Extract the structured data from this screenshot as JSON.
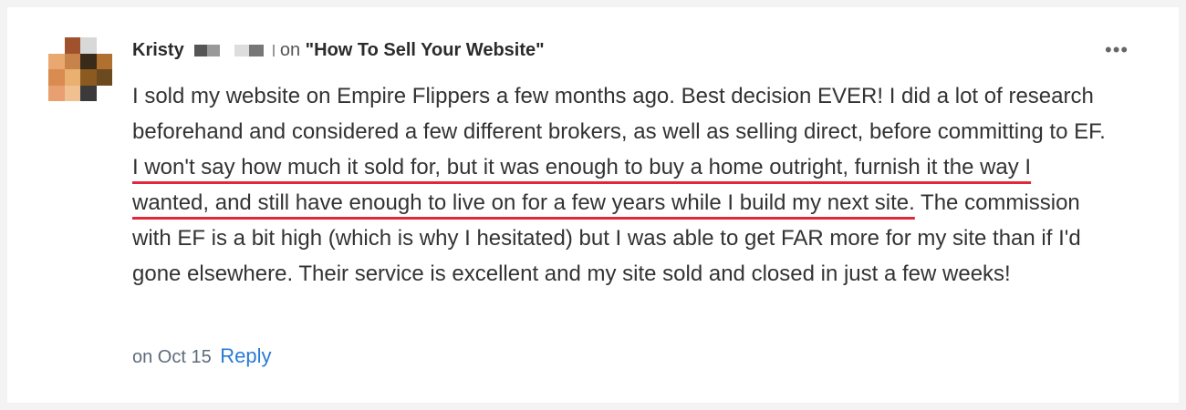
{
  "comment": {
    "author": "Kristy",
    "on_label": "on",
    "post_title": "\"How To Sell Your Website\"",
    "more_icon": "more-horizontal-icon",
    "text_before": "I sold my website on Empire Flippers a few months ago. Best decision EVER! I did a lot of research beforehand and considered a few different brokers, as well as selling direct, before committing to EF. ",
    "text_highlight": "I won't say how much it sold for, but it was enough to buy a home outright, furnish it the way I wanted, and still have enough to live on for a few years while I build my next site.",
    "text_after": " The commission with EF is a bit high (which is why I hesitated) but I was able to get FAR more for my site than if I'd gone elsewhere. Their service is excellent and my site sold and closed in just a few weeks!",
    "date": "on Oct 15",
    "reply_label": "Reply",
    "highlight_color": "#e0283a",
    "link_color": "#2a7bd5"
  }
}
